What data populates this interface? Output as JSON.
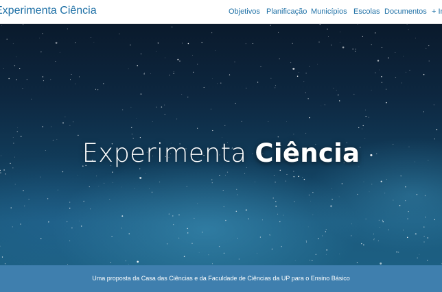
{
  "navbar": {
    "brand": "Experimenta Ciência",
    "links": [
      {
        "label": "Objetivos"
      },
      {
        "label": "Planificação"
      },
      {
        "label": "Municípios"
      },
      {
        "label": "Escolas"
      },
      {
        "label": "Documentos"
      },
      {
        "label": "+ In"
      }
    ]
  },
  "hero": {
    "title_light": "Experimenta",
    "title_bold": "Ciência"
  },
  "footer": {
    "tagline": "Uma proposta da Casa das Ciências e da Faculdade de Ciências da UP para o Ensino Básico"
  },
  "colors": {
    "link": "#1c6fa5",
    "tagline_bar": "#3f7fae",
    "hero_sky": "#0d2740"
  }
}
